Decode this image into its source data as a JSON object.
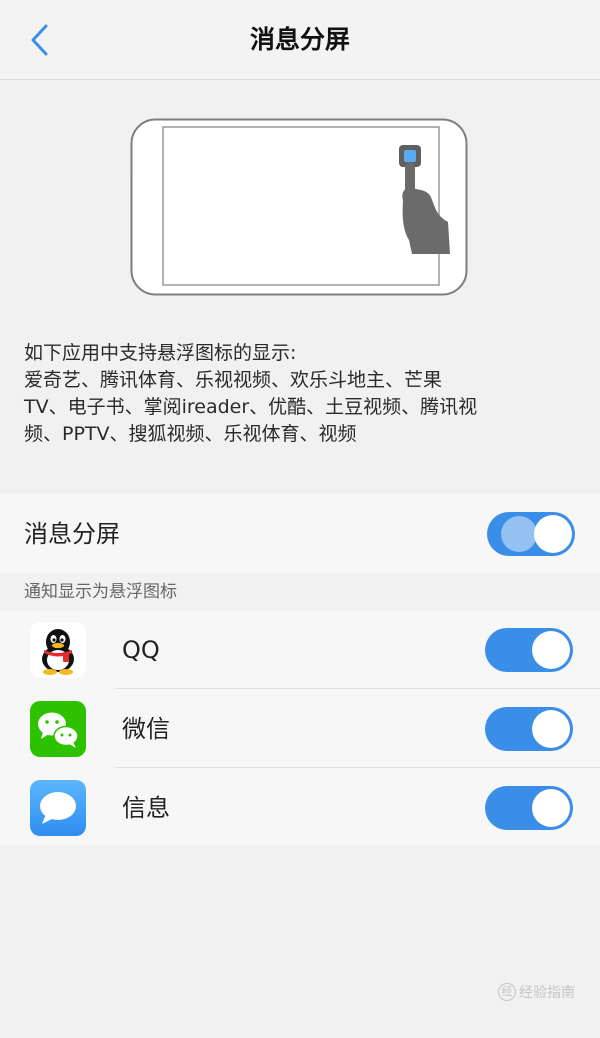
{
  "header": {
    "title": "消息分屏"
  },
  "description": {
    "line1": "如下应用中支持悬浮图标的显示:",
    "line2": "爱奇艺、腾讯体育、乐视视频、欢乐斗地主、芒果",
    "line3": "TV、电子书、掌阅ireader、优酷、土豆视频、腾讯视",
    "line4": "频、PPTV、搜狐视频、乐视体育、视频"
  },
  "main_toggle": {
    "label": "消息分屏",
    "on": true
  },
  "section": {
    "label": "通知显示为悬浮图标"
  },
  "apps": [
    {
      "name": "QQ",
      "icon": "qq-penguin-icon",
      "on": true
    },
    {
      "name": "微信",
      "icon": "wechat-icon",
      "on": true
    },
    {
      "name": "信息",
      "icon": "messages-icon",
      "on": true
    }
  ],
  "colors": {
    "accent": "#3b8ee8",
    "wechat_green": "#2dc100",
    "messages_blue": "#3a9df5"
  },
  "watermark": {
    "badge": "经",
    "text": "经验指南"
  }
}
